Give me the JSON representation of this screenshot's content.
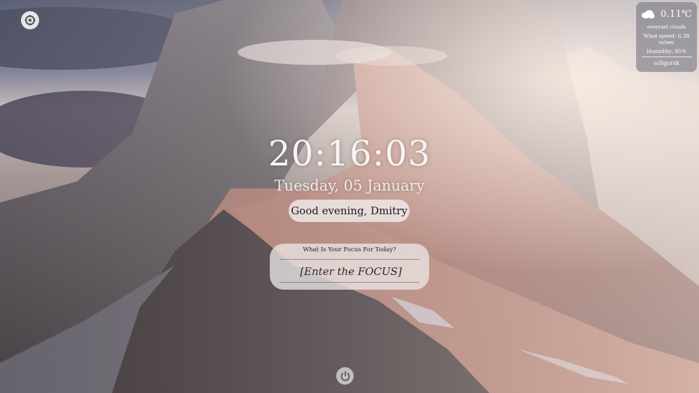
{
  "weather": {
    "temperature": "0.11℃",
    "description": "overcast clouds",
    "wind": "Wind speed: 6.38 m/sec",
    "humidity": "Humidity: 95%",
    "city": "soligorsk",
    "icon": "cloud-icon"
  },
  "clock": {
    "time": "20:16:03",
    "date": "Tuesday, 05 January"
  },
  "greeting": {
    "text": "Good evening, Dmitry"
  },
  "focus": {
    "question": "What Is Your Focus For Today?",
    "placeholder": "[Enter the FOCUS]"
  },
  "controls": {
    "settings_icon": "settings-icon",
    "power_icon": "power-icon"
  },
  "background": {
    "description_icon": "mountain-background"
  }
}
